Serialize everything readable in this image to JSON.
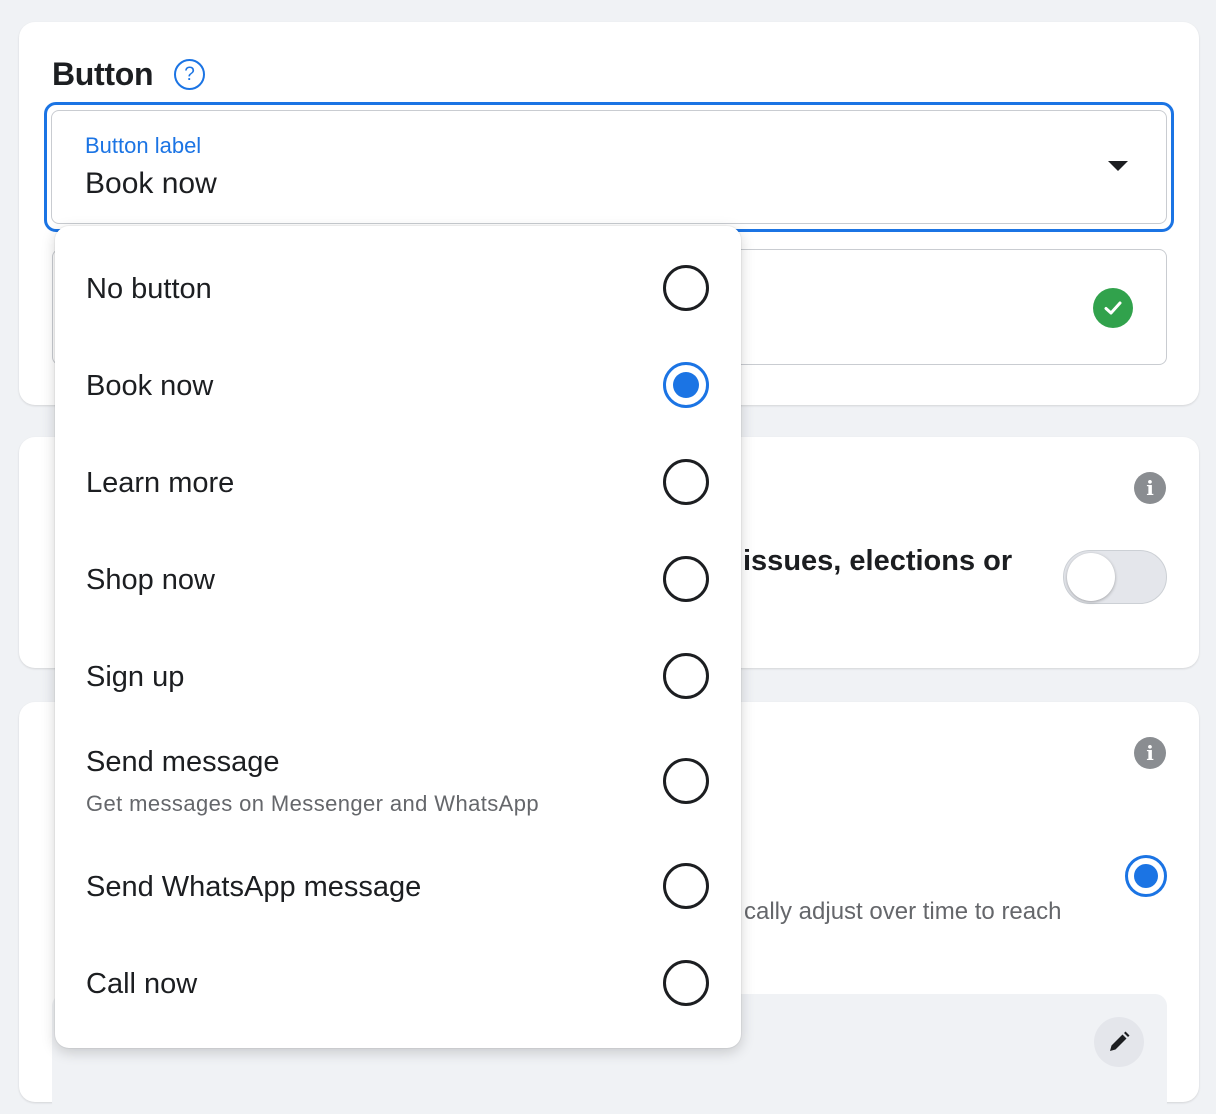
{
  "button_section": {
    "title": "Button",
    "help_glyph": "?",
    "select": {
      "label": "Button label",
      "value": "Book now"
    }
  },
  "background_text": {
    "issues_line": "issues, elections or",
    "adjust_line": "cally adjust over time to reach"
  },
  "dropdown": {
    "options": [
      {
        "label": "No button",
        "selected": false
      },
      {
        "label": "Book now",
        "selected": true
      },
      {
        "label": "Learn more",
        "selected": false
      },
      {
        "label": "Shop now",
        "selected": false
      },
      {
        "label": "Sign up",
        "selected": false
      },
      {
        "label": "Send message",
        "sublabel": "Get messages on Messenger and WhatsApp",
        "selected": false
      },
      {
        "label": "Send WhatsApp message",
        "selected": false
      },
      {
        "label": "Call now",
        "selected": false
      }
    ]
  },
  "colors": {
    "accent": "#1b74e4",
    "success": "#31a24c",
    "background": "#f0f2f5"
  },
  "icons": [
    "help-icon",
    "caret-down-icon",
    "check-circle-icon",
    "info-icon",
    "pencil-icon"
  ]
}
